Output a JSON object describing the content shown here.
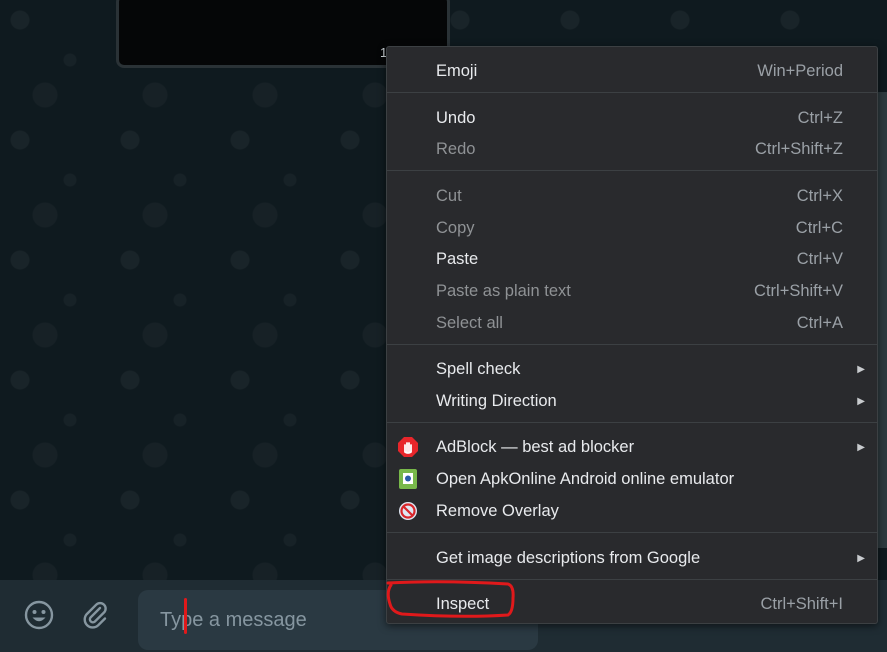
{
  "chat": {
    "media_count": "1"
  },
  "composer": {
    "placeholder": "Type a message",
    "emoji_icon": "emoji-icon",
    "attach_icon": "paperclip-icon"
  },
  "context_menu": {
    "items": [
      {
        "label": "Emoji",
        "shortcut": "Win+Period",
        "enabled": true
      },
      {
        "label": "Undo",
        "shortcut": "Ctrl+Z",
        "enabled": true
      },
      {
        "label": "Redo",
        "shortcut": "Ctrl+Shift+Z",
        "enabled": false
      },
      {
        "label": "Cut",
        "shortcut": "Ctrl+X",
        "enabled": false
      },
      {
        "label": "Copy",
        "shortcut": "Ctrl+C",
        "enabled": false
      },
      {
        "label": "Paste",
        "shortcut": "Ctrl+V",
        "enabled": true
      },
      {
        "label": "Paste as plain text",
        "shortcut": "Ctrl+Shift+V",
        "enabled": false
      },
      {
        "label": "Select all",
        "shortcut": "Ctrl+A",
        "enabled": false
      },
      {
        "label": "Spell check",
        "submenu": true,
        "enabled": true
      },
      {
        "label": "Writing Direction",
        "submenu": true,
        "enabled": true
      },
      {
        "label": "AdBlock — best ad blocker",
        "submenu": true,
        "icon": "adblock-hand-icon",
        "enabled": true
      },
      {
        "label": "Open ApkOnline Android online emulator",
        "icon": "apkonline-icon",
        "enabled": true
      },
      {
        "label": "Remove Overlay",
        "icon": "remove-overlay-icon",
        "enabled": true
      },
      {
        "label": "Get image descriptions from Google",
        "submenu": true,
        "enabled": true
      },
      {
        "label": "Inspect",
        "shortcut": "Ctrl+Shift+I",
        "enabled": true
      }
    ]
  },
  "colors": {
    "menu_bg": "#292a2d",
    "text_enabled": "#e8eaed",
    "text_disabled": "#8f9295",
    "annotation_red": "#e0191b",
    "composer_bg": "#1f2c33"
  }
}
